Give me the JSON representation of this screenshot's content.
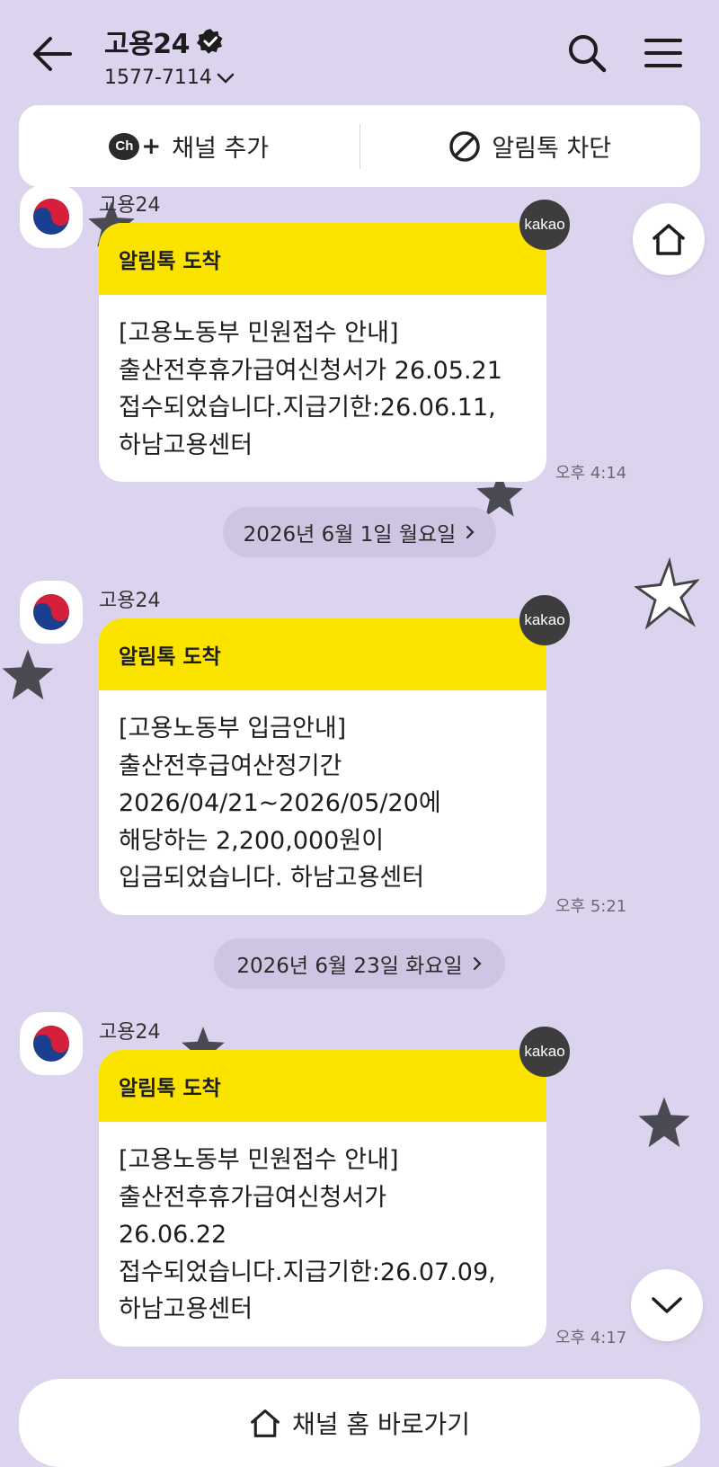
{
  "header": {
    "channel_name": "고용24",
    "phone": "1577-7114"
  },
  "actions": {
    "add_channel_label": "채널 추가",
    "block_label": "알림톡 차단"
  },
  "date_separators": [
    "2026년 6월 1일 월요일",
    "2026년 6월 23일 화요일"
  ],
  "messages": [
    {
      "sender": "고용24",
      "header": "알림톡 도착",
      "badge": "kakao",
      "lines": [
        "[고용노동부 민원접수 안내]",
        "출산전후휴가급여신청서가 26.05.21",
        "접수되었습니다.지급기한:26.06.11,",
        "하남고용센터"
      ],
      "time": "오후 4:14"
    },
    {
      "sender": "고용24",
      "header": "알림톡 도착",
      "badge": "kakao",
      "lines": [
        "[고용노동부 입금안내]",
        "출산전후급여산정기간",
        "2026/04/21~2026/05/20에",
        "해당하는 2,200,000원이",
        "입금되었습니다. 하남고용센터"
      ],
      "time": "오후 5:21"
    },
    {
      "sender": "고용24",
      "header": "알림톡 도착",
      "badge": "kakao",
      "lines": [
        "[고용노동부 민원접수 안내]",
        "출산전후휴가급여신청서가",
        "26.06.22",
        "접수되었습니다.지급기한:26.07.09,",
        "하남고용센터"
      ],
      "time": "오후 4:17"
    }
  ],
  "footer": {
    "home_label": "채널 홈 바로가기"
  },
  "colors": {
    "background": "#dcd3ee",
    "alimtalk_header": "#fbe300",
    "kakao_badge": "#3d3d3d"
  }
}
